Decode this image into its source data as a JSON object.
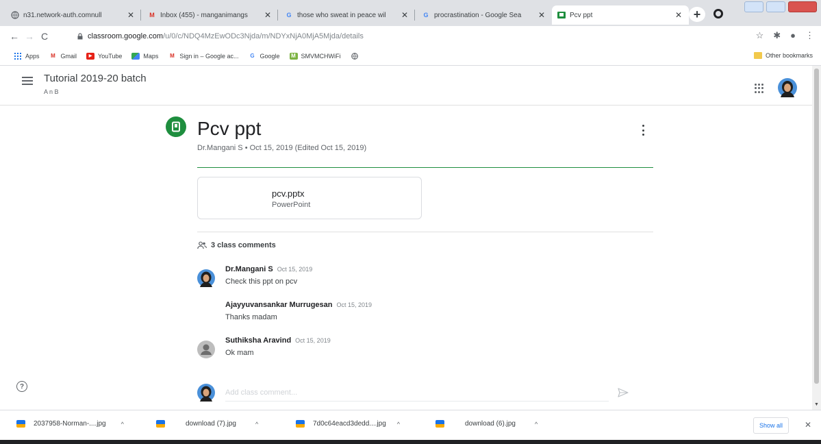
{
  "browser": {
    "tabs": [
      {
        "title": "n31.network-auth.comnull",
        "favicon": "globe-icon"
      },
      {
        "title": "Inbox (455) - manganimangs",
        "favicon": "gmail-icon"
      },
      {
        "title": "those who sweat in peace wil",
        "favicon": "google-icon"
      },
      {
        "title": "procrastination - Google Sea",
        "favicon": "google-icon"
      },
      {
        "title": "Pcv ppt",
        "favicon": "classroom-icon",
        "active": true
      }
    ],
    "url_host": "classroom.google.com",
    "url_path": "/u/0/c/NDQ4MzEwODc3Njda/m/NDYxNjA0MjA5Mjda/details",
    "bookmarks": [
      {
        "label": "Apps",
        "icon": "apps-grid-icon"
      },
      {
        "label": "Gmail",
        "icon": "gmail-icon"
      },
      {
        "label": "YouTube",
        "icon": "youtube-icon"
      },
      {
        "label": "Maps",
        "icon": "maps-icon"
      },
      {
        "label": "Sign in – Google ac...",
        "icon": "gmail-icon"
      },
      {
        "label": "Google",
        "icon": "google-icon"
      },
      {
        "label": "SMVMCHWiFi",
        "icon": "bookmark-icon"
      },
      {
        "label": "",
        "icon": "globe-icon"
      }
    ],
    "other_bookmarks": "Other bookmarks"
  },
  "classroom": {
    "class_title": "Tutorial 2019-20 batch",
    "class_section": "A n B"
  },
  "post": {
    "title": "Pcv ppt",
    "meta": "Dr.Mangani S • Oct 15, 2019 (Edited Oct 15, 2019)",
    "attachment": {
      "name": "pcv.pptx",
      "type": "PowerPoint"
    },
    "comments_heading": "3 class comments",
    "comments": [
      {
        "author": "Dr.Mangani S",
        "date": "Oct 15, 2019",
        "text": "Check this ppt on pcv",
        "avatar": "user-photo"
      },
      {
        "author": "Ajayyuvansankar Murrugesan",
        "date": "Oct 15, 2019",
        "text": "Thanks madam",
        "avatar": "none"
      },
      {
        "author": "Suthiksha Aravind",
        "date": "Oct 15, 2019",
        "text": "Ok mam",
        "avatar": "default"
      }
    ],
    "add_comment_placeholder": "Add class comment..."
  },
  "downloads": {
    "items": [
      {
        "name": "2037958-Norman-....jpg"
      },
      {
        "name": "download (7).jpg"
      },
      {
        "name": "7d0c64eacd3dedd....jpg"
      },
      {
        "name": "download (6).jpg"
      }
    ],
    "show_all": "Show all"
  },
  "colors": {
    "classroom_green": "#1e8e3e",
    "link_blue": "#1a73e8"
  }
}
